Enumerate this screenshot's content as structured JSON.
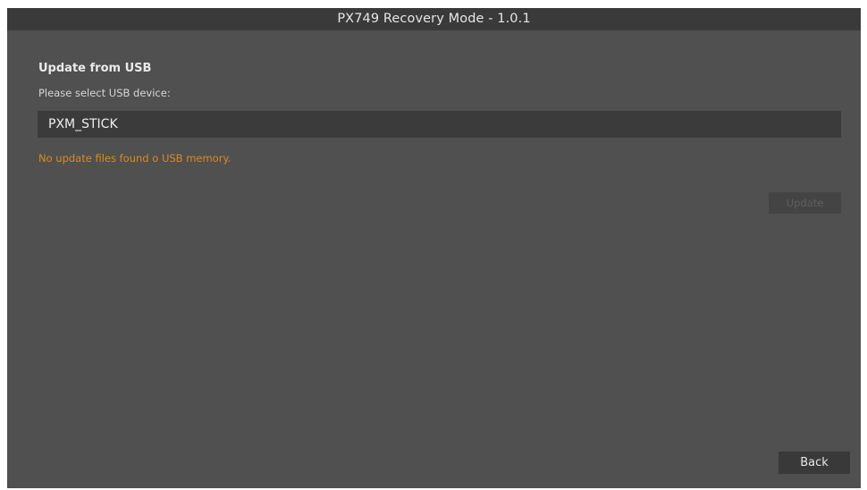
{
  "window": {
    "title": "PX749 Recovery Mode - 1.0.1"
  },
  "main": {
    "section_title": "Update from USB",
    "prompt": "Please select USB device:",
    "selected_device": "PXM_STICK",
    "status_message": "No update files found o USB memory.",
    "status_color": "#d88a22",
    "update_label": "Update",
    "update_enabled": false
  },
  "footer": {
    "back_label": "Back"
  }
}
